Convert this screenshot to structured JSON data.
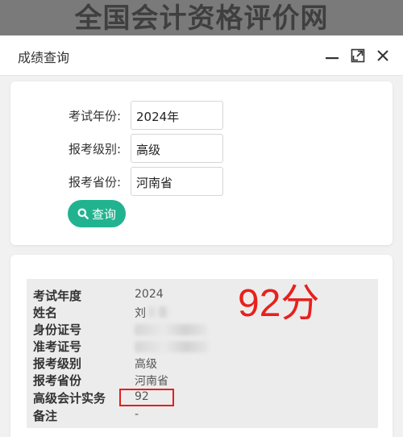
{
  "banner": {
    "text": "全国会计资格评价网"
  },
  "dialog": {
    "title": "成绩查询",
    "controls": {
      "minimize": "minimize-icon",
      "maximize": "maximize-icon",
      "close": "close-icon"
    }
  },
  "query_form": {
    "fields": [
      {
        "label": "考试年份:",
        "value": "2024年"
      },
      {
        "label": "报考级别:",
        "value": "高级"
      },
      {
        "label": "报考省份:",
        "value": "河南省"
      }
    ],
    "query_button": "查询",
    "button_color": "#21b38f"
  },
  "result": {
    "annotation": "92分",
    "annotation_color": "#e8201c",
    "rows": [
      {
        "label": "考试年度",
        "value": "2024"
      },
      {
        "label": "姓名",
        "value": "刘"
      },
      {
        "label": "身份证号",
        "value": ""
      },
      {
        "label": "准考证号",
        "value": ""
      },
      {
        "label": "报考级别",
        "value": "高级"
      },
      {
        "label": "报考省份",
        "value": "河南省"
      },
      {
        "label": "高级会计实务",
        "value": "92"
      },
      {
        "label": "备注",
        "value": "-"
      }
    ]
  }
}
